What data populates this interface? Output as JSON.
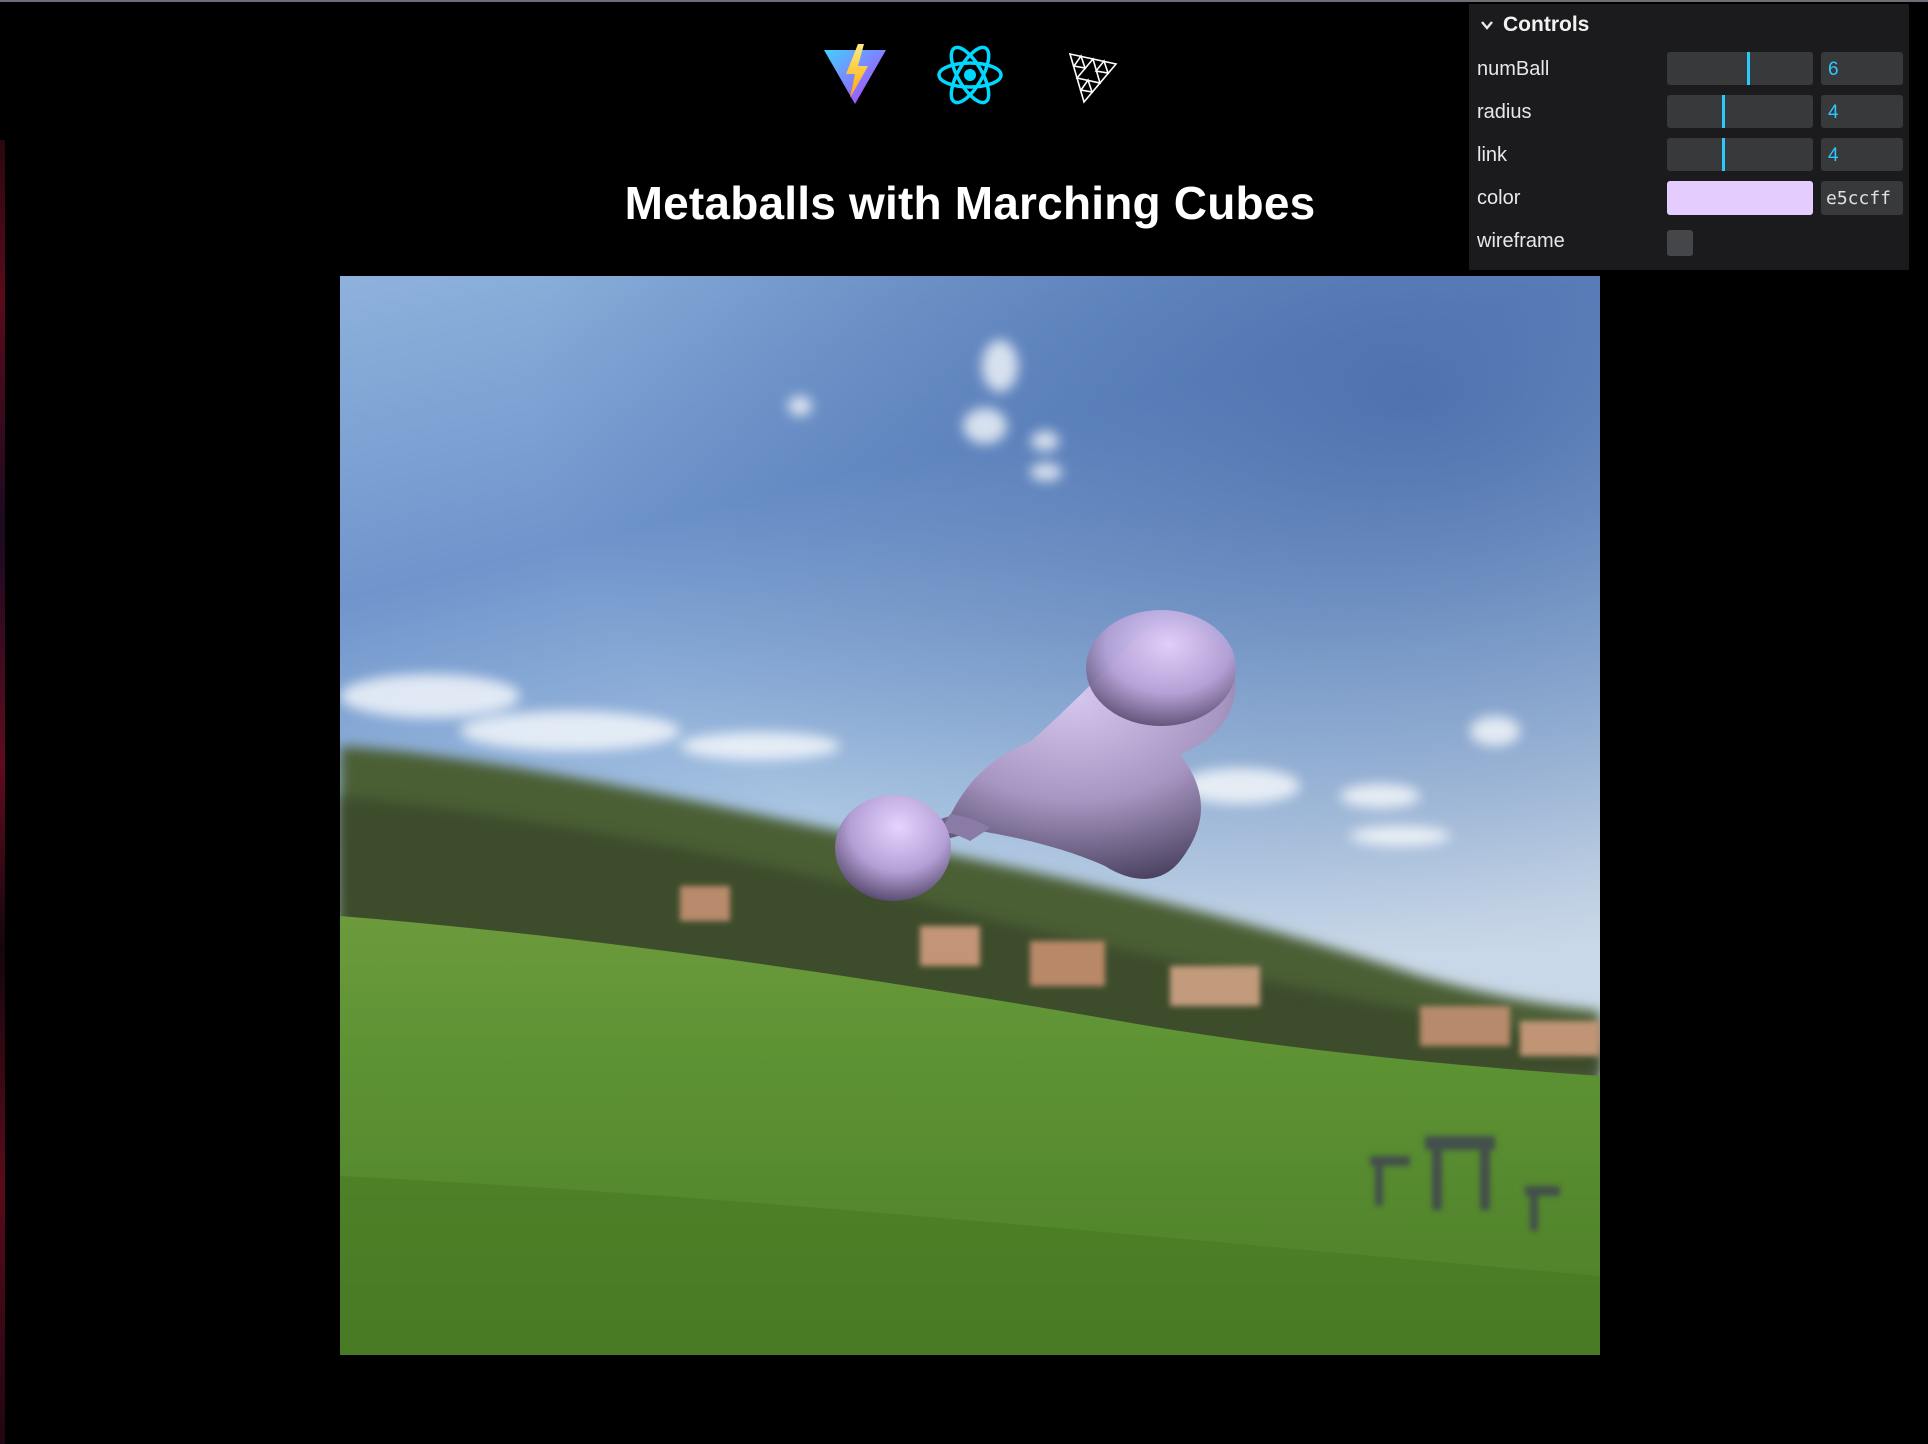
{
  "page": {
    "title": "Metaballs with Marching Cubes"
  },
  "logos": [
    {
      "name": "vite-icon"
    },
    {
      "name": "react-icon"
    },
    {
      "name": "threejs-icon"
    }
  ],
  "controls": {
    "title": "Controls",
    "rows": {
      "numBall": {
        "label": "numBall",
        "value": "6",
        "fraction": 0.55
      },
      "radius": {
        "label": "radius",
        "value": "4",
        "fraction": 0.38
      },
      "link": {
        "label": "link",
        "value": "4",
        "fraction": 0.38
      },
      "color": {
        "label": "color",
        "value": "e5ccff",
        "hex": "#e5ccff"
      },
      "wireframe": {
        "label": "wireframe",
        "checked": false
      }
    }
  },
  "colors": {
    "accent": "#2cc9ff",
    "panel_bg": "#1b1b1d",
    "metaball": "#e5ccff"
  }
}
